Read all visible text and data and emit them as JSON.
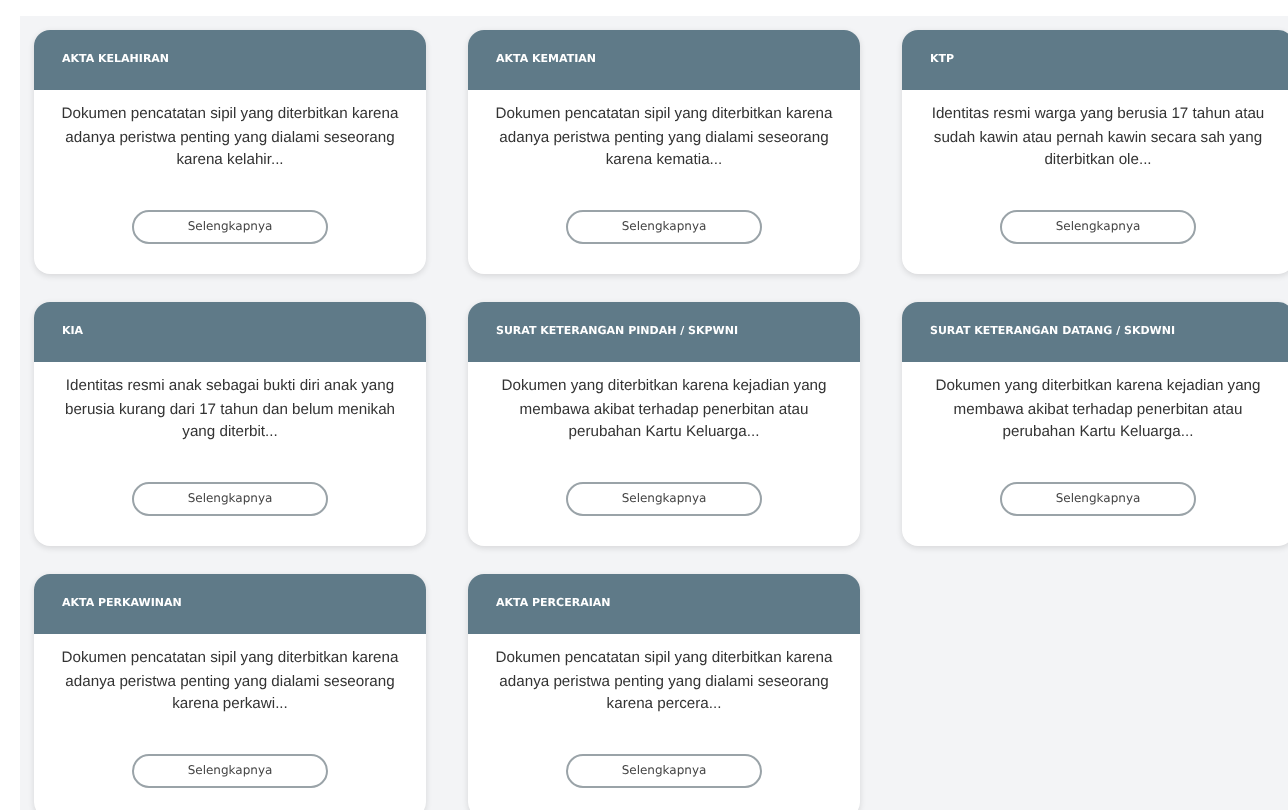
{
  "cards": [
    {
      "title": "AKTA KELAHIRAN",
      "description": "Dokumen pencatatan sipil yang diterbitkan karena adanya peristwa penting yang dialami seseorang karena kelahir...",
      "button": "Selengkapnya"
    },
    {
      "title": "AKTA KEMATIAN",
      "description": "Dokumen pencatatan sipil yang diterbitkan karena adanya peristwa penting yang dialami seseorang karena kematia...",
      "button": "Selengkapnya"
    },
    {
      "title": "KTP",
      "description": "Identitas resmi warga yang berusia 17 tahun atau sudah kawin atau pernah kawin secara sah yang diterbitkan ole...",
      "button": "Selengkapnya"
    },
    {
      "title": "KIA",
      "description": "Identitas resmi anak sebagai bukti diri anak yang berusia kurang dari 17 tahun dan belum menikah yang diterbit...",
      "button": "Selengkapnya"
    },
    {
      "title": "SURAT KETERANGAN PINDAH / SKPWNI",
      "description": "Dokumen yang diterbitkan karena kejadian yang membawa akibat terhadap penerbitan atau perubahan Kartu Keluarga...",
      "button": "Selengkapnya"
    },
    {
      "title": "SURAT KETERANGAN DATANG / SKDWNI",
      "description": "Dokumen yang diterbitkan karena kejadian yang membawa akibat terhadap penerbitan atau perubahan Kartu Keluarga...",
      "button": "Selengkapnya"
    },
    {
      "title": "AKTA PERKAWINAN",
      "description": "Dokumen pencatatan sipil yang diterbitkan karena adanya peristwa penting yang dialami seseorang karena perkawi...",
      "button": "Selengkapnya"
    },
    {
      "title": "AKTA PERCERAIAN",
      "description": "Dokumen pencatatan sipil yang diterbitkan karena adanya peristwa penting yang dialami seseorang karena percera...",
      "button": "Selengkapnya"
    }
  ]
}
